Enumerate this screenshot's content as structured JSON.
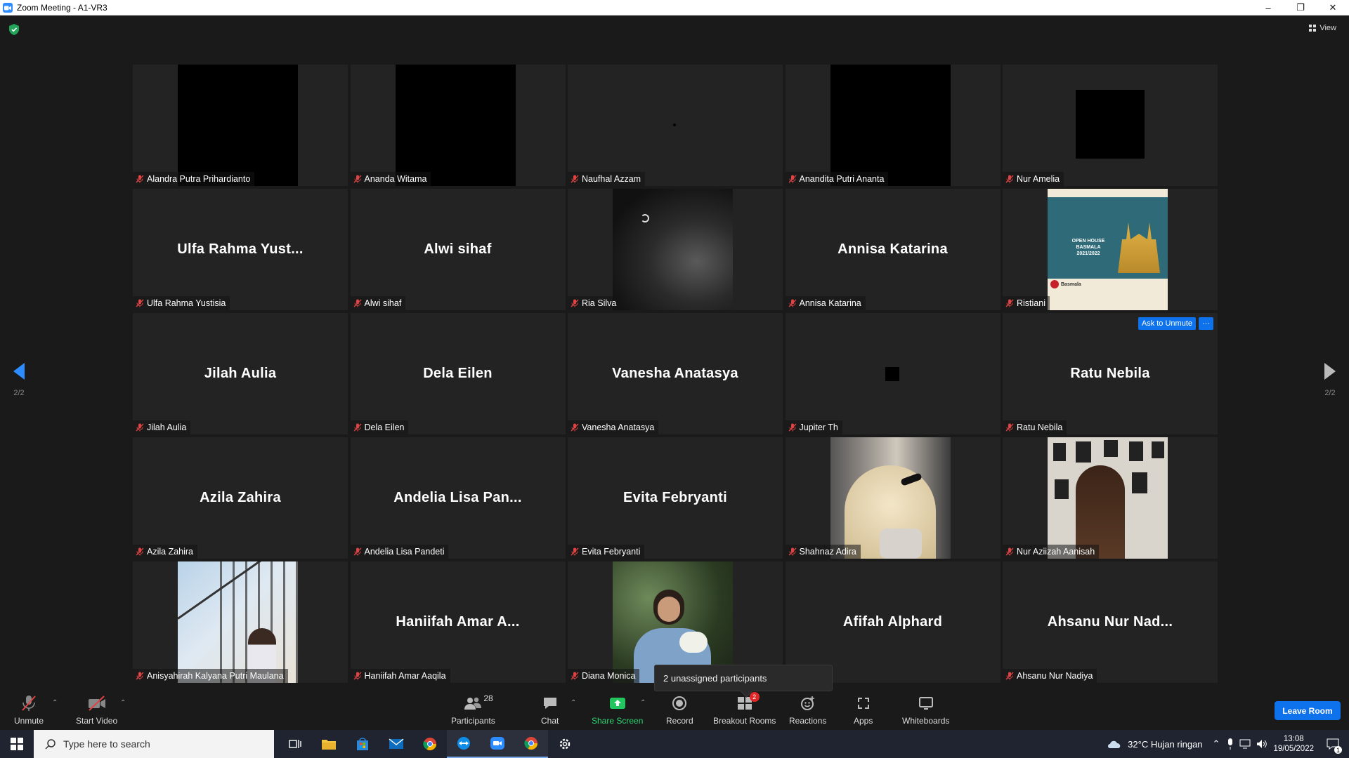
{
  "window": {
    "title": "Zoom Meeting - A1-VR3",
    "minimize": "–",
    "maximize": "❐",
    "close": "✕"
  },
  "view_button": {
    "label": "View"
  },
  "pager": {
    "left": "2/2",
    "right": "2/2"
  },
  "tiles": [
    {
      "caption": "Alandra Putra Prihardianto",
      "big": "",
      "kind": "black"
    },
    {
      "caption": "Ananda Witama",
      "big": "",
      "kind": "black"
    },
    {
      "caption": "Naufhal Azzam",
      "big": "",
      "kind": "dot"
    },
    {
      "caption": "Anandita Putri Ananta",
      "big": "",
      "kind": "black"
    },
    {
      "caption": "Nur Amelia",
      "big": "",
      "kind": "square"
    },
    {
      "caption": "Ulfa Rahma Yustisia",
      "big": "Ulfa Rahma Yust...",
      "kind": "name"
    },
    {
      "caption": "Alwi sihaf",
      "big": "Alwi sihaf",
      "kind": "name"
    },
    {
      "caption": "Ria Silva",
      "big": "",
      "kind": "night"
    },
    {
      "caption": "Annisa Katarina",
      "big": "Annisa Katarina",
      "kind": "name"
    },
    {
      "caption": "Ristiani",
      "big": "",
      "kind": "poster"
    },
    {
      "caption": "Jilah Aulia",
      "big": "Jilah Aulia",
      "kind": "name"
    },
    {
      "caption": "Dela Eilen",
      "big": "Dela Eilen",
      "kind": "name"
    },
    {
      "caption": "Vanesha Anatasya",
      "big": "Vanesha Anatasya",
      "kind": "name"
    },
    {
      "caption": "Jupiter Th",
      "big": "",
      "kind": "smallsquare"
    },
    {
      "caption": "Ratu Nebila",
      "big": "Ratu Nebila",
      "kind": "name"
    },
    {
      "caption": "Azila Zahira",
      "big": "Azila Zahira",
      "kind": "name"
    },
    {
      "caption": "Andelia Lisa Pandeti",
      "big": "Andelia Lisa Pan...",
      "kind": "name"
    },
    {
      "caption": "Evita Febryanti",
      "big": "Evita Febryanti",
      "kind": "name"
    },
    {
      "caption": "Shahnaz Adira",
      "big": "",
      "kind": "hair"
    },
    {
      "caption": "Nur Aziizah Aanisah",
      "big": "",
      "kind": "gallery"
    },
    {
      "caption": "Anisyahirah Kalyana Putri Maulana",
      "big": "",
      "kind": "stairs"
    },
    {
      "caption": "Haniifah Amar Aaqila",
      "big": "Haniifah Amar A...",
      "kind": "name"
    },
    {
      "caption": "Diana Monica",
      "big": "",
      "kind": "plant"
    },
    {
      "caption": "lphard",
      "big": "Afifah Alphard",
      "kind": "name"
    },
    {
      "caption": "Ahsanu Nur Nadiya",
      "big": "Ahsanu Nur Nad...",
      "kind": "name"
    }
  ],
  "poster": {
    "line1": "OPEN HOUSE",
    "line2": "BASMALA",
    "line3": "2021/2022",
    "brand": "Basmala"
  },
  "ask_unmute": {
    "label": "Ask to Unmute",
    "more": "···"
  },
  "tooltip": "2 unassigned participants",
  "toolbar": {
    "unmute": "Unmute",
    "start_video": "Start Video",
    "participants": "Participants",
    "participants_count": "28",
    "chat": "Chat",
    "share_screen": "Share Screen",
    "record": "Record",
    "breakout_rooms": "Breakout Rooms",
    "breakout_badge": "2",
    "reactions": "Reactions",
    "apps": "Apps",
    "whiteboards": "Whiteboards",
    "leave": "Leave Room"
  },
  "taskbar": {
    "search_placeholder": "Type here to search",
    "weather": "32°C  Hujan ringan",
    "time": "13:08",
    "date": "19/05/2022",
    "notif_count": "1"
  },
  "colors": {
    "accent": "#0e72ed",
    "share_green": "#22c55e",
    "badge_red": "#e02828",
    "muted_red": "#e04343"
  }
}
